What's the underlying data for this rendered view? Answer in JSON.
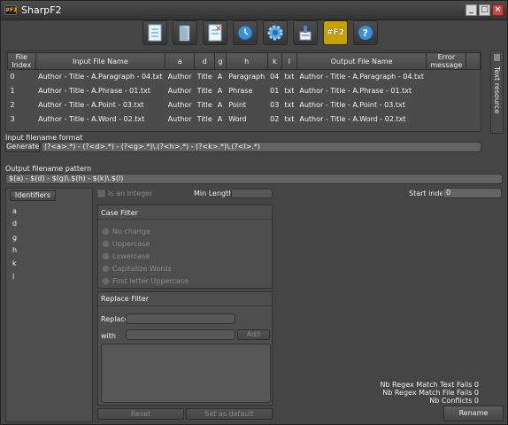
{
  "window": {
    "title": "SharpF2",
    "app_icon_text": "#F2"
  },
  "toolbar": {
    "buttons": [
      "document-icon",
      "folder-icon",
      "document-delete-icon",
      "clock-icon",
      "gear-icon",
      "stamp-icon",
      "f2-icon",
      "help-icon"
    ],
    "f2_text": "#F2"
  },
  "grid": {
    "columns": [
      "File Index",
      "Input File Name",
      "a",
      "d",
      "g",
      "h",
      "k",
      "l",
      "Output File Name",
      "Error message"
    ],
    "rows": [
      [
        "0",
        "Author - Title - A.Paragraph - 04.txt",
        "Author",
        "Title",
        "A",
        "Paragraph",
        "04",
        "txt",
        "Author - Title - A.Paragraph - 04.txt",
        ""
      ],
      [
        "1",
        "Author - Title - A.Phrase - 01.txt",
        "Author",
        "Title",
        "A",
        "Phrase",
        "01",
        "txt",
        "Author - Title - A.Phrase - 01.txt",
        ""
      ],
      [
        "2",
        "Author - Title - A.Point - 03.txt",
        "Author",
        "Title",
        "A",
        "Point",
        "03",
        "txt",
        "Author - Title - A.Point - 03.txt",
        ""
      ],
      [
        "3",
        "Author - Title - A.Word - 02.txt",
        "Author",
        "Title",
        "A",
        "Word",
        "02",
        "txt",
        "Author - Title - A.Word - 02.txt",
        ""
      ]
    ]
  },
  "side_tab": {
    "label": "Text resource"
  },
  "input_format": {
    "label": "Input filename format",
    "generate": "Generate",
    "value": "(?<a>.*) - (?<d>.*) - (?<g>.*)\\.(?<h>.*) - (?<k>.*)\\.(?<l>.*)"
  },
  "output_pattern": {
    "label": "Output filename pattern",
    "value": "$(a) - $(d) - $(g)\\.$(h) - $(k)\\.$(l)"
  },
  "identifiers": {
    "header": "Identifiers",
    "items": [
      "a",
      "d",
      "g",
      "h",
      "k",
      "l"
    ]
  },
  "options": {
    "is_an_integer": "Is an Integer",
    "min_length": "Min Length",
    "start_index": "Start index",
    "start_value": "0"
  },
  "case_filter": {
    "title": "Case Filter",
    "options": [
      "No change",
      "Uppercase",
      "Lowercase",
      "Capitalize Words",
      "First letter Uppercase"
    ]
  },
  "replace_filter": {
    "title": "Replace Filter",
    "replace": "Replace",
    "with": "with",
    "add": "Add"
  },
  "footer": {
    "reset": "Reset",
    "set_default": "Set as default",
    "rename": "Rename"
  },
  "stats": {
    "regex_text_fails": "Nb Regex Match Text Fails 0",
    "regex_file_fails": "Nb Regex Match File Fails 0",
    "conflicts": "Nb Conflicts 0"
  }
}
